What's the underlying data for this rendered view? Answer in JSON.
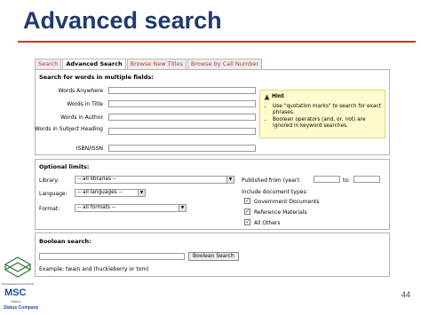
{
  "slide": {
    "title": "Advanced search",
    "page_number": "44"
  },
  "tabs": [
    "Search",
    "Advanced Search",
    "Browse New Titles",
    "Browse by Call Number"
  ],
  "words_section": {
    "heading": "Search for words in multiple fields:",
    "fields": [
      "Words Anywhere",
      "Words in Title",
      "Words in Author",
      "Words in Subject Heading",
      "ISBN/ISSN"
    ]
  },
  "hint": {
    "title": "Hint",
    "items": [
      "Use \"quotation marks\" to search for exact phrases.",
      "Boolean operators (and, or, not) are ignored in keyword searches."
    ]
  },
  "limits": {
    "heading": "Optional limits:",
    "library_label": "Library:",
    "library_value": "-- all libraries --",
    "language_label": "Language:",
    "language_value": "-- all languages --",
    "format_label": "Format:",
    "format_value": "-- all formats --",
    "published_from_label": "Published from (year):",
    "to_label": "to:",
    "doc_types_label": "Include document types:",
    "doc_types": [
      {
        "label": "Government Documents",
        "checked": true
      },
      {
        "label": "Reference Materials",
        "checked": true
      },
      {
        "label": "All Others",
        "checked": true
      }
    ]
  },
  "boolean": {
    "heading": "Boolean search:",
    "button": "Boolean Search",
    "example": "Example: twain and (huckleberry or tom)"
  },
  "logo": {
    "top_text": "Perpustakaan Universiti Malaysia",
    "brand": "MSC",
    "sub1": "Status",
    "sub2": "Status Company"
  }
}
